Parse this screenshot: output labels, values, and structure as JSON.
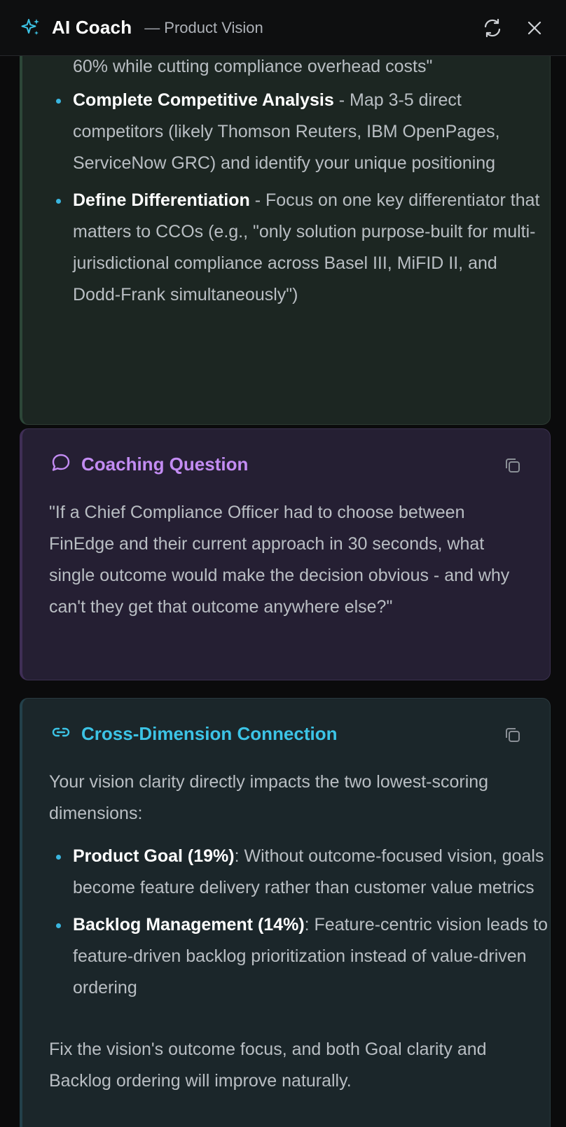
{
  "header": {
    "title": "AI Coach",
    "dash": "—",
    "subtitle": "Product Vision",
    "icons": [
      "sparkle-icon",
      "refresh-icon",
      "close-icon"
    ]
  },
  "recommendations": {
    "top_cut_text": "60% while cutting compliance overhead costs\"",
    "items": [
      {
        "title": "Complete Competitive Analysis",
        "text": " - Map 3-5 direct competitors (likely Thomson Reuters, IBM OpenPages, ServiceNow GRC) and identify your unique positioning"
      },
      {
        "title": "Define Differentiation",
        "text": " - Focus on one key differentiator that matters to CCOs (e.g., \"only solution purpose-built for multi-jurisdictional compliance across Basel III, MiFID II, and Dodd-Frank simultaneously\")"
      }
    ]
  },
  "coaching_question": {
    "label": "Coaching Question",
    "text": "\"If a Chief Compliance Officer had to choose between FinEdge and their current approach in 30 seconds, what single outcome would make the decision obvious - and why can't they get that outcome anywhere else?\""
  },
  "cross_dimension": {
    "label": "Cross-Dimension Connection",
    "intro": "Your vision clarity directly impacts the two lowest-scoring dimensions:",
    "items": [
      {
        "title": "Product Goal (19%)",
        "text": ": Without outcome-focused vision, goals become feature delivery rather than customer value metrics"
      },
      {
        "title": "Backlog Management (14%)",
        "text": ": Feature-centric vision leads to feature-driven backlog prioritization instead of value-driven ordering"
      }
    ],
    "outro": "Fix the vision's outcome focus, and both Goal clarity and Backlog ordering will improve naturally."
  },
  "colors": {
    "purple_accent": "#c38cf3",
    "teal_accent": "#3cc4e6",
    "bullet": "#3ab6e0",
    "sparkle": "#3cc4e6"
  }
}
